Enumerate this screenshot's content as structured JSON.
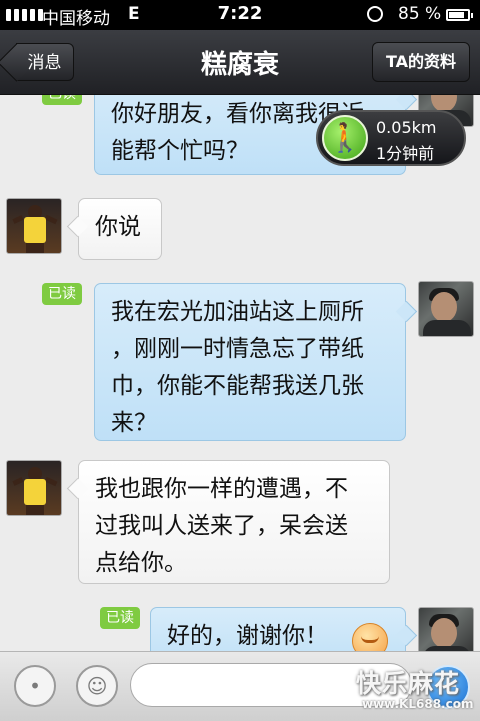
{
  "status_bar": {
    "carrier": "中国移动",
    "network": "E",
    "time": "7:22",
    "battery": "85 %",
    "battery_level": 0.85
  },
  "nav": {
    "back_label": "消息",
    "title": "糕腐衰",
    "profile_label": "TA的资料"
  },
  "distance": {
    "value": "0.05km",
    "time_ago": "1分钟前"
  },
  "messages": [
    {
      "side": "out",
      "read": "已读",
      "text": "你好朋友，看你离我很近\n能帮个忙吗？"
    },
    {
      "side": "in",
      "text": "你说"
    },
    {
      "side": "out",
      "read": "已读",
      "text": "我在宏光加油站这上厕所\n，刚刚一时情急忘了带纸\n巾，你能不能帮我送几张\n来？"
    },
    {
      "side": "in",
      "text": "我也跟你一样的遭遇，不\n过我叫人送来了，呆会送\n点给你。"
    },
    {
      "side": "out",
      "read": "已读",
      "text": "好的，谢谢你！"
    }
  ],
  "input": {
    "value": "",
    "placeholder": ""
  },
  "watermark": {
    "text": "快乐麻花",
    "url": "www.KL688.com"
  },
  "colors": {
    "read_badge": "#7fcb41",
    "outgoing_bubble": "#c8e4f8",
    "nav_bar": "#2b2c30"
  }
}
